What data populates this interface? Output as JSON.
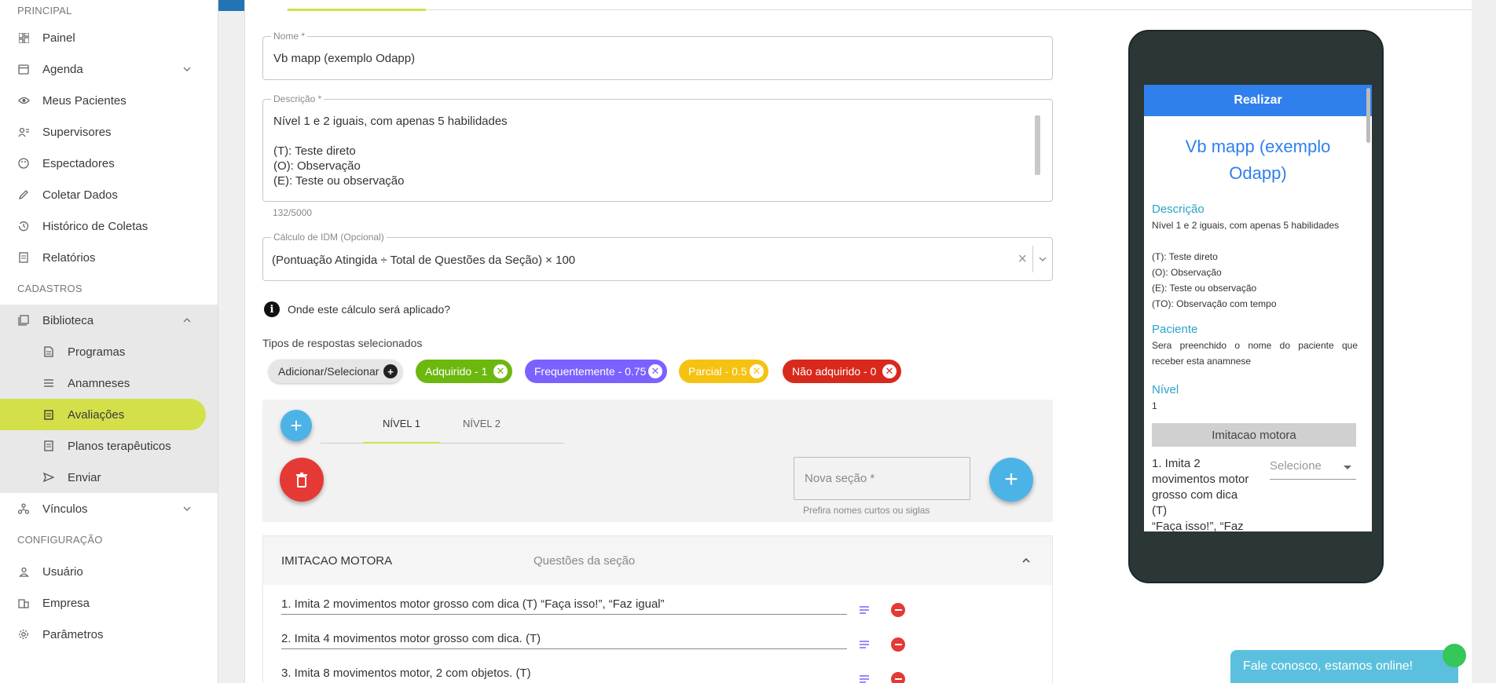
{
  "sidebar": {
    "sections": [
      "PRINCIPAL",
      "CADASTROS",
      "CONFIGURAÇÃO"
    ],
    "main_items": [
      "Painel",
      "Agenda",
      "Meus Pacientes",
      "Supervisores",
      "Espectadores",
      "Coletar Dados",
      "Histórico de Coletas",
      "Relatórios"
    ],
    "library": "Biblioteca",
    "library_items": [
      "Programas",
      "Anamneses",
      "Avaliações",
      "Planos terapêuticos",
      "Enviar"
    ],
    "links": "Vínculos",
    "config_items": [
      "Usuário",
      "Empresa",
      "Parâmetros"
    ]
  },
  "form": {
    "name_label": "Nome *",
    "name_value": "Vb mapp (exemplo Odapp)",
    "desc_label": "Descrição *",
    "desc_lines": [
      "Nível 1 e 2 iguais, com apenas 5 habilidades",
      "",
      "(T): Teste direto",
      "(O): Observação",
      "(E): Teste ou observação"
    ],
    "desc_counter": "132/5000",
    "idm_label": "Cálculo de IDM (Opcional)",
    "idm_value": "(Pontuação Atingida ÷ Total de Questões da Seção) × 100",
    "idm_clear": "×",
    "info_text": "Onde este cálculo será aplicado?",
    "response_types_title": "Tipos de respostas selecionados",
    "add_select_label": "Adicionar/Selecionar",
    "chips": [
      {
        "label": "Adquirido - 1",
        "color": "#6cb80f"
      },
      {
        "label": "Frequentemente - 0.75",
        "color": "#7b61ff"
      },
      {
        "label": "Parcial - 0.5",
        "color": "#f5c211"
      },
      {
        "label": "Não adquirido - 0",
        "color": "#d9281c"
      }
    ]
  },
  "levels": {
    "tabs": [
      "NÍVEL 1",
      "NÍVEL 2"
    ],
    "new_section_placeholder": "Nova seção *",
    "new_section_hint": "Prefira nomes curtos ou siglas"
  },
  "section": {
    "name": "IMITACAO MOTORA",
    "questions_label": "Questões da seção",
    "questions": [
      "1. Imita 2 movimentos motor grosso com dica (T) “Faça isso!”, “Faz igual”",
      "2. Imita 4 movimentos motor grosso com dica. (T)",
      "3. Imita 8 movimentos motor, 2 com objetos. (T)"
    ]
  },
  "phone": {
    "button": "Realizar",
    "title_line1": "Vb mapp (exemplo",
    "title_line2": "Odapp)",
    "desc_label": "Descrição",
    "desc_lines": [
      "Nível 1 e 2 iguais, com apenas 5 habilidades",
      "",
      "(T): Teste direto",
      "(O): Observação",
      "(E): Teste ou observação",
      "(TO): Observação com tempo"
    ],
    "patient_label": "Paciente",
    "patient_text": "Sera preenchido o nome do paciente que receber esta anamnese",
    "level_label": "Nível",
    "level_value": "1",
    "section_name": "Imitacao motora",
    "question_lines": [
      "1. Imita 2",
      "movimentos motor",
      "grosso com dica (T)",
      "“Faça isso!”, “Faz"
    ],
    "select_placeholder": "Selecione"
  },
  "chat": {
    "label": "Fale conosco, estamos online!"
  },
  "colors": {
    "accent": "#d4e04a",
    "primary_blue": "#2f80ed",
    "fab_blue": "#4cb3e6",
    "danger": "#e53935"
  }
}
